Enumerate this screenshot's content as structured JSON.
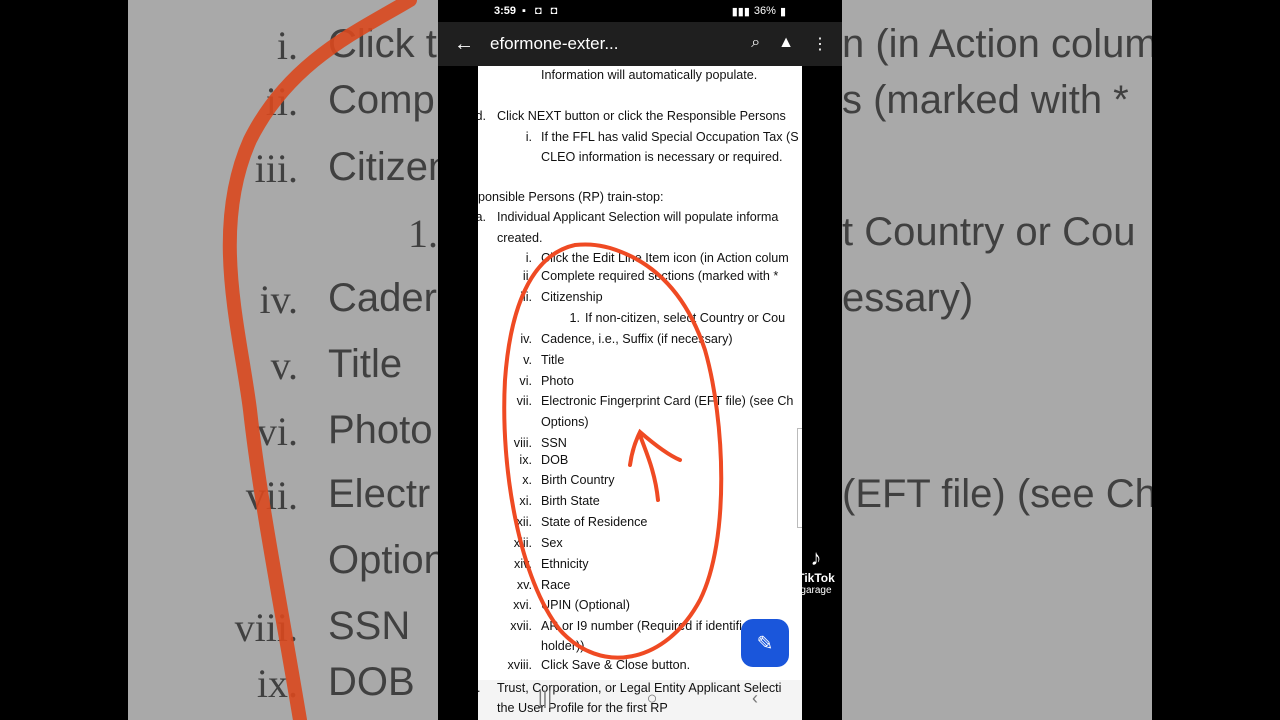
{
  "status_bar": {
    "time": "3:59",
    "notif_icons": "▪ ◘ ◘",
    "battery": "36%"
  },
  "app_bar": {
    "title": "eformone-exter..."
  },
  "backdrop": {
    "lines": [
      {
        "num": "i.",
        "text": "Click t"
      },
      {
        "num": "ii.",
        "text": "Comp"
      },
      {
        "num": "iii.",
        "text": "Citizen"
      },
      {
        "num": "1.",
        "text": ""
      },
      {
        "num": "iv.",
        "text": "Cader"
      },
      {
        "num": "v.",
        "text": "Title"
      },
      {
        "num": "vi.",
        "text": "Photo"
      },
      {
        "num": "vii.",
        "text": "Electr"
      },
      {
        "num": "",
        "text": "Option"
      },
      {
        "num": "viii.",
        "text": "SSN"
      },
      {
        "num": "ix.",
        "text": "DOB"
      }
    ],
    "right_fragments": [
      "n (in Action colum",
      "s (marked with *",
      "t Country or Cou",
      "essary)",
      "(EFT file) (see Ch"
    ]
  },
  "document": {
    "lines": [
      {
        "num": "",
        "text": "Information will automatically populate."
      },
      {
        "num": "d.",
        "text": "Click NEXT button or click the Responsible Persons"
      },
      {
        "num": "i.",
        "text": "If the FFL has valid Special Occupation Tax (S"
      },
      {
        "num": "",
        "text": "CLEO information is necessary or required."
      },
      {
        "num": "",
        "text": "ponsible Persons (RP) train-stop:"
      },
      {
        "num": "a.",
        "text": "Individual Applicant Selection will populate informa"
      },
      {
        "num": "",
        "text": "created."
      },
      {
        "num": "i.",
        "text": "Click the Edit Line Item icon (in Action colum"
      },
      {
        "num": "ii.",
        "text": "Complete required sections (marked with *"
      },
      {
        "num": "iii.",
        "text": "Citizenship"
      },
      {
        "num": "1.",
        "text": "If non-citizen, select Country or Cou"
      },
      {
        "num": "iv.",
        "text": "Cadence, i.e., Suffix (if necessary)"
      },
      {
        "num": "v.",
        "text": "Title"
      },
      {
        "num": "vi.",
        "text": "Photo"
      },
      {
        "num": "vii.",
        "text": "Electronic Fingerprint Card (EFT file) (see Ch"
      },
      {
        "num": "",
        "text": "Options)"
      },
      {
        "num": "viii.",
        "text": "SSN"
      },
      {
        "num": "ix.",
        "text": "DOB"
      },
      {
        "num": "x.",
        "text": "Birth Country"
      },
      {
        "num": "xi.",
        "text": "Birth State"
      },
      {
        "num": "xii.",
        "text": "State of Residence"
      },
      {
        "num": "xiii.",
        "text": "Sex"
      },
      {
        "num": "xiv.",
        "text": "Ethnicity"
      },
      {
        "num": "xv.",
        "text": "Race"
      },
      {
        "num": "xvi.",
        "text": "UPIN (Optional)"
      },
      {
        "num": "xvii.",
        "text": "AR or I9 number (Required if identifies a"
      },
      {
        "num": "",
        "text": "holder))"
      },
      {
        "num": "xviii.",
        "text": "Click Save & Close button."
      }
    ],
    "bottom_lines": [
      {
        "num": "b.",
        "text": "Trust, Corporation, or Legal Entity Applicant Selecti"
      },
      {
        "num": "",
        "text": "the User Profile for the first RP"
      }
    ]
  },
  "tiktok": {
    "name": "TikTok",
    "user": "garage"
  },
  "colors": {
    "annotation": "#ef4a23",
    "fab": "#1a56db"
  },
  "icons": [
    "back-arrow-icon",
    "find-in-page-icon",
    "drive-add-icon",
    "more-vert-icon",
    "edit-pen-icon",
    "tiktok-logo-icon"
  ]
}
